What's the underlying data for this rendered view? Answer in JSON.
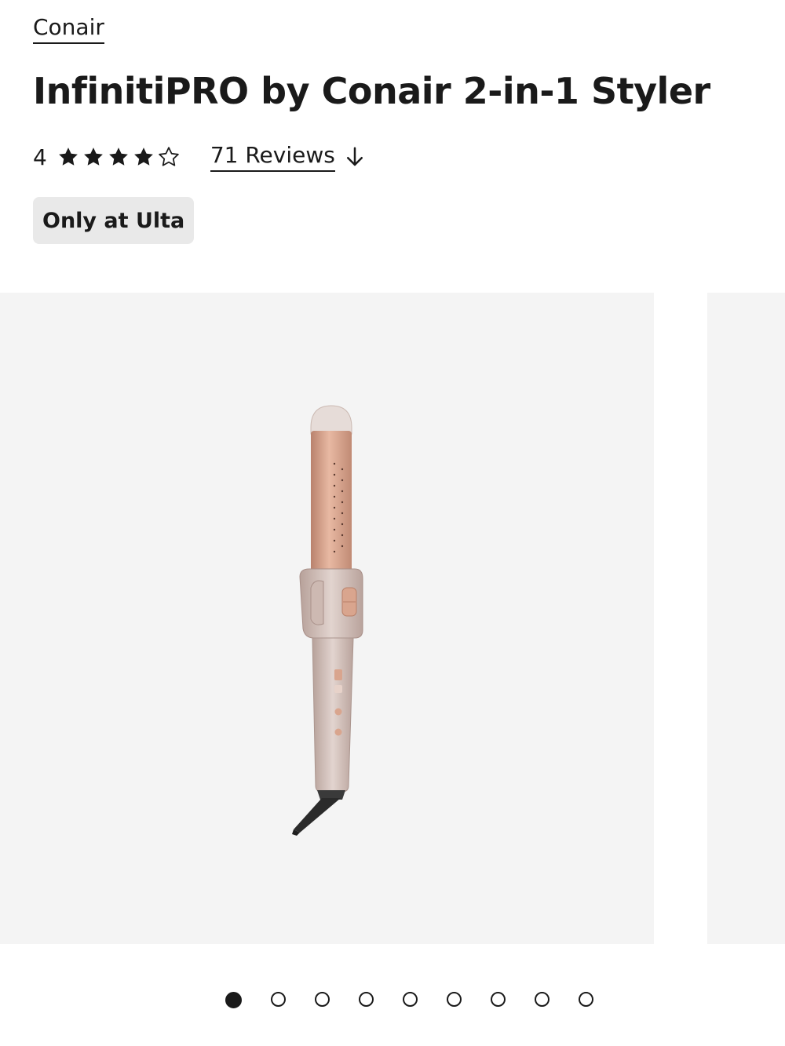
{
  "product": {
    "brand": "Conair",
    "name": "InfinitiPRO by Conair 2-in-1 Styler",
    "rating_value": "4",
    "rating_stars": 4,
    "rating_max": 5,
    "reviews_label": "71 Reviews",
    "badge": "Only at Ulta"
  },
  "icons": {
    "star_filled": "star-filled-icon",
    "star_empty": "star-outline-icon",
    "reviews_arrow": "arrow-down-icon"
  },
  "carousel": {
    "slide_count": 9,
    "active_index": 0
  },
  "colors": {
    "text": "#1a1a1a",
    "badge_bg": "#e9e9e9",
    "image_bg": "#f4f4f4",
    "product_rose_gold": "#d9a58e"
  }
}
